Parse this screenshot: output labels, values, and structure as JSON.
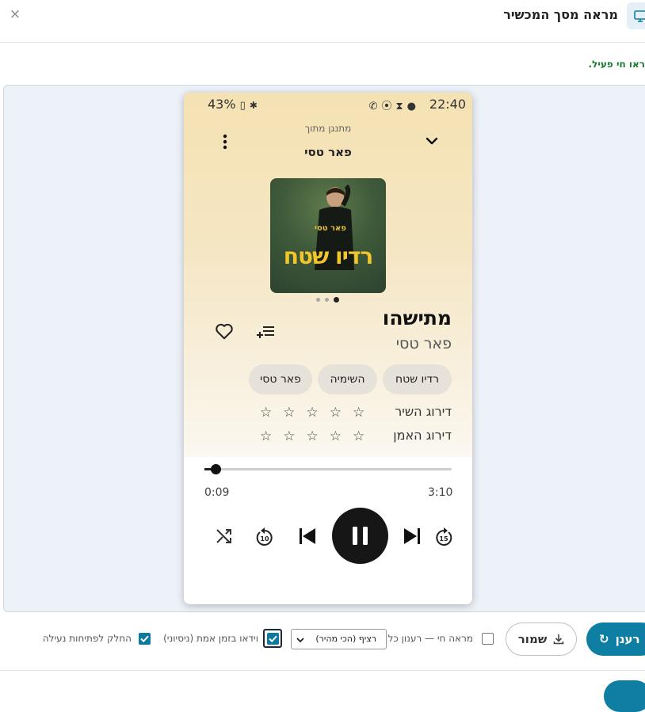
{
  "dialog": {
    "title": "מראה מסך המכשיר",
    "close": "×",
    "status": "ראו חי פעיל."
  },
  "phone": {
    "status_bar": {
      "time": "22:40",
      "battery": "43%"
    },
    "playing_from_label": "מתנגן מתוך",
    "source_name": "פאר טסי",
    "cover": {
      "artist_text": "פאר טסי",
      "title_text": "רדיו שטח"
    },
    "song_title": "מתישהו",
    "artist": "פאר טסי",
    "chips": [
      "רדיו שטח",
      "השימיה",
      "פאר טסי"
    ],
    "rating": {
      "song_label": "דירוג השיר",
      "artist_label": "דירוג האמן",
      "song_stars": "☆☆☆☆☆",
      "artist_stars": "☆☆☆☆☆"
    },
    "progress": {
      "elapsed": "0:09",
      "duration": "3:10",
      "fraction": 0.047
    },
    "page_dots": {
      "count": 3,
      "active": 2
    }
  },
  "controls": {
    "refresh_label": "רענן",
    "save_label": "שמור",
    "live_refresh_label": "מראה חי — רענון כל",
    "live_refresh_checked": false,
    "interval_value": "רציף (הכי מהיר)",
    "realtime_video_label": "וידאו בזמן אמת (ניסיוני)",
    "realtime_video_checked": true,
    "smooth_label": "החלק לפתיחות נעילה",
    "smooth_checked": true
  },
  "colors": {
    "accent": "#0e7fa3",
    "status_green": "#1a7a2e",
    "panel_bg": "#edf1f8"
  }
}
